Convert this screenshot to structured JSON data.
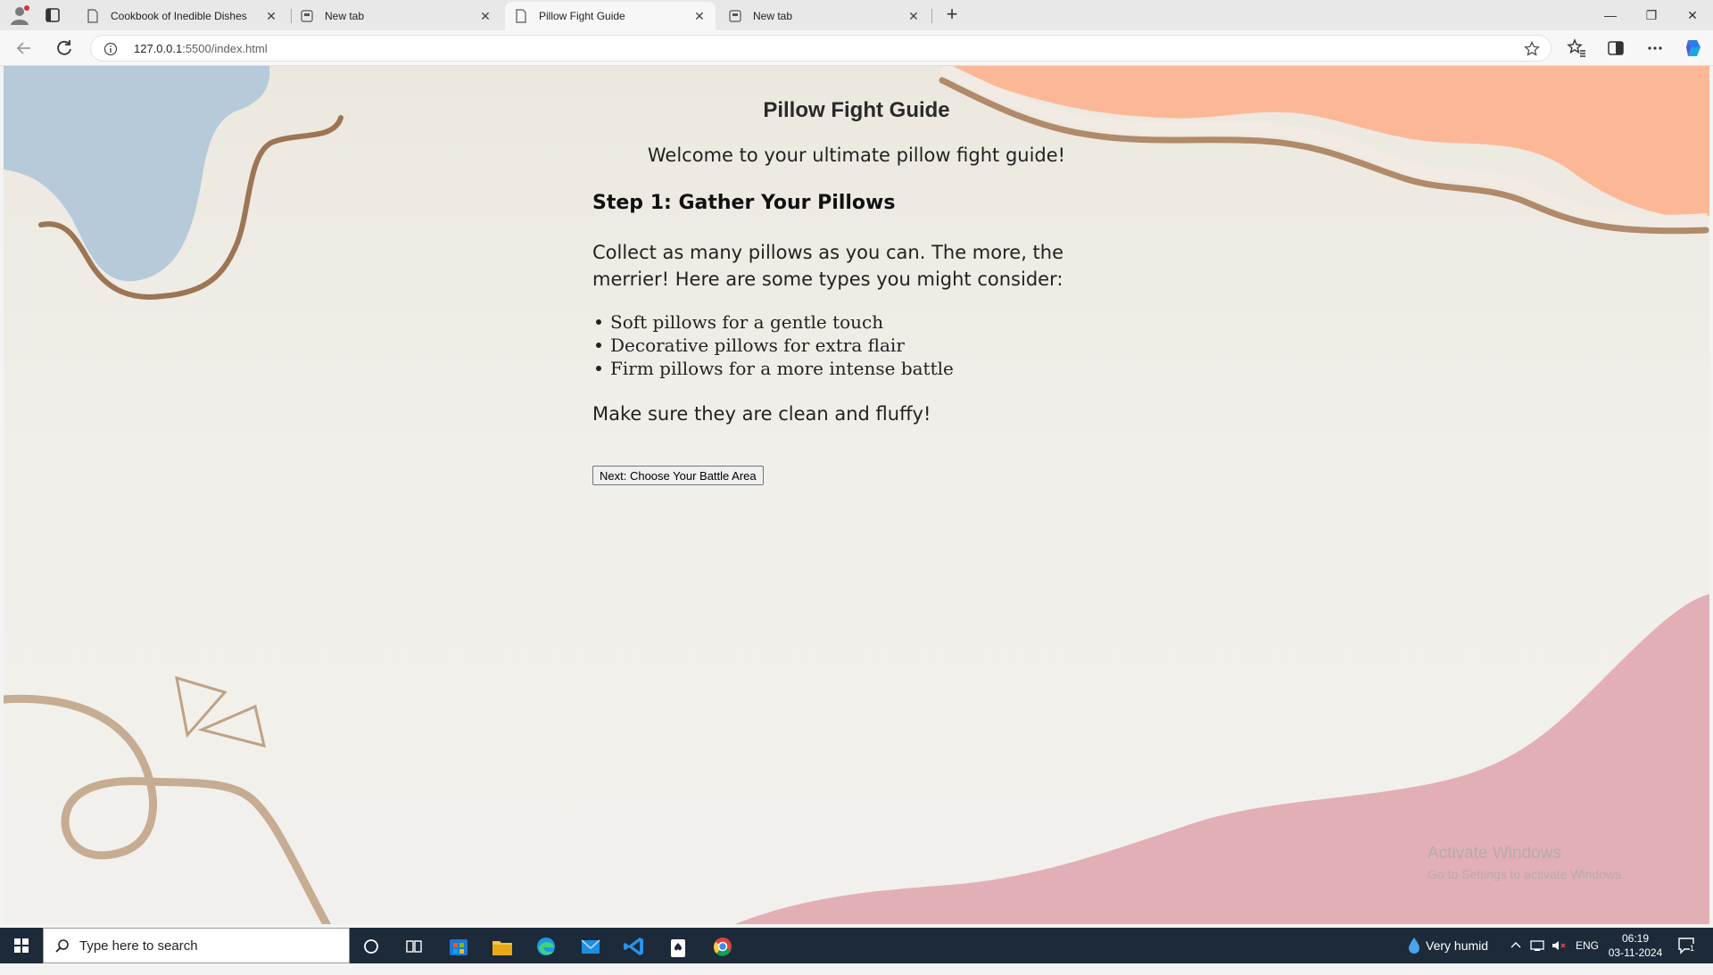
{
  "browser": {
    "tabs": [
      {
        "label": "Cookbook of Inedible Dishes",
        "active": false
      },
      {
        "label": "New tab",
        "active": false
      },
      {
        "label": "Pillow Fight Guide",
        "active": true
      },
      {
        "label": "New tab",
        "active": false
      }
    ],
    "address": {
      "host": "127.0.0.1",
      "path": ":5500/index.html"
    }
  },
  "page": {
    "title": "Pillow Fight Guide",
    "welcome": "Welcome to your ultimate pillow fight guide!",
    "step_heading": "Step 1: Gather Your Pillows",
    "paragraph": "Collect as many pillows as you can. The more, the merrier! Here are some types you might consider:",
    "pillow_types": [
      "Soft pillows for a gentle touch",
      "Decorative pillows for extra flair",
      "Firm pillows for a more intense battle"
    ],
    "closing": "Make sure they are clean and fluffy!",
    "next_button": "Next: Choose Your Battle Area",
    "colors": {
      "blue_blob": "#b6cad9",
      "orange_blob": "#fcb896",
      "pink_blob": "#e2afb7",
      "brown_line": "#9c7555",
      "tan_line": "#c6ac92"
    }
  },
  "watermark": {
    "line1": "Activate Windows",
    "line2": "Go to Settings to activate Windows."
  },
  "taskbar": {
    "search_placeholder": "Type here to search",
    "weather": "Very humid",
    "language": "ENG",
    "time": "06:19",
    "date": "03-11-2024",
    "notification_count": "1"
  }
}
